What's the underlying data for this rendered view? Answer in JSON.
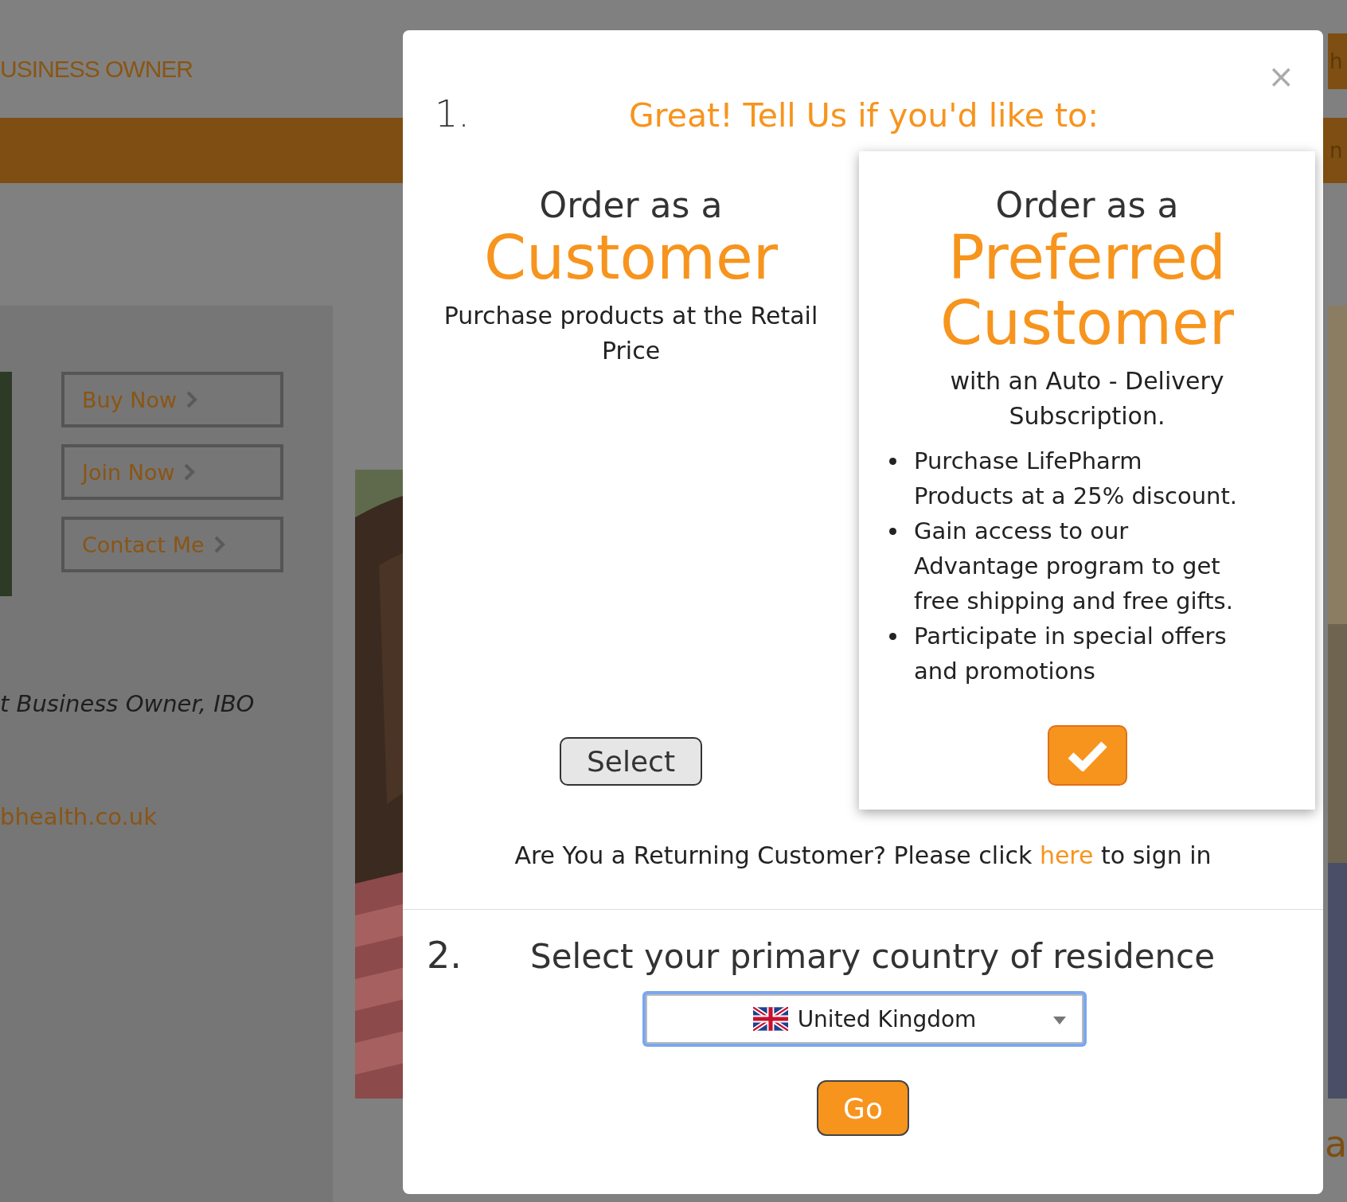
{
  "background": {
    "header_text": "USINESS OWNER",
    "side_buttons": [
      "Buy Now",
      "Join Now",
      "Contact Me"
    ],
    "role": "t Business Owner, IBO",
    "website": "bhealth.co.uk",
    "edge_texts": [
      "h",
      "n",
      "a"
    ]
  },
  "dialog": {
    "close": "×",
    "step1": {
      "number": "1.",
      "title": "Great! Tell Us if you'd like to:",
      "options": [
        {
          "prefix": "Order as a",
          "title_lines": [
            "Customer"
          ],
          "description": "Purchase products at the Retail Price",
          "button": "Select",
          "selected": false
        },
        {
          "prefix": "Order as a",
          "title_lines": [
            "Preferred",
            "Customer"
          ],
          "description": "with an Auto - Delivery Subscription.",
          "bullets": [
            "Purchase LifePharm Products at a 25% discount.",
            "Gain access to our Advantage program to get free shipping and free gifts.",
            "Participate in special offers and promotions"
          ],
          "selected": true
        }
      ]
    },
    "returning": {
      "text": "Are You a Returning Customer? Please click",
      "link": "here",
      "suffix": "to sign in"
    },
    "step2": {
      "number": "2.",
      "title": "Select your primary country of residence",
      "country": "United Kingdom",
      "button": "Go"
    }
  }
}
